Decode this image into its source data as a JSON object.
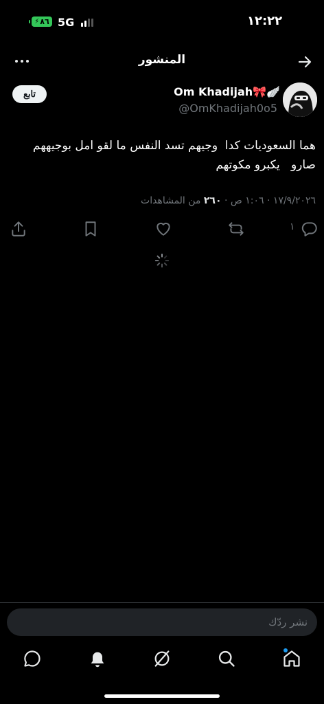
{
  "status_bar": {
    "battery": "٨٦",
    "network": "5G",
    "time": "١٢:٢٢"
  },
  "header": {
    "title": "المنشور"
  },
  "author": {
    "name": "Om Khadijah🎀🪽",
    "handle": "@OmKhadijah0o5",
    "follow_label": "تابع"
  },
  "post": {
    "text": "هما السعوديات كدا  وجيهم تسد النفس ما لقو امل بوجيههم صارو   يكبرو مكوتهم",
    "date_time": "١٧/٩/٢٠٢٦ · ١:٠٦ ص",
    "views_count": "٢٦٠",
    "views_label": "من المشاهدات"
  },
  "actions": {
    "reply_count": "١"
  },
  "composer": {
    "placeholder": "نشر ردّك"
  },
  "icons": {
    "back": "arrow-right-icon",
    "more": "more-dots-icon",
    "reply": "reply-bubble-icon",
    "repost": "repost-icon",
    "like": "heart-icon",
    "bookmark": "bookmark-icon",
    "share": "share-icon",
    "home": "home-icon",
    "search": "search-icon",
    "grok": "grok-icon",
    "notifications": "bell-icon",
    "messages": "message-icon"
  },
  "colors": {
    "background": "#000000",
    "text": "#e7e9ea",
    "muted": "#71767b",
    "accent": "#1d9bf0",
    "battery": "#34c759"
  }
}
